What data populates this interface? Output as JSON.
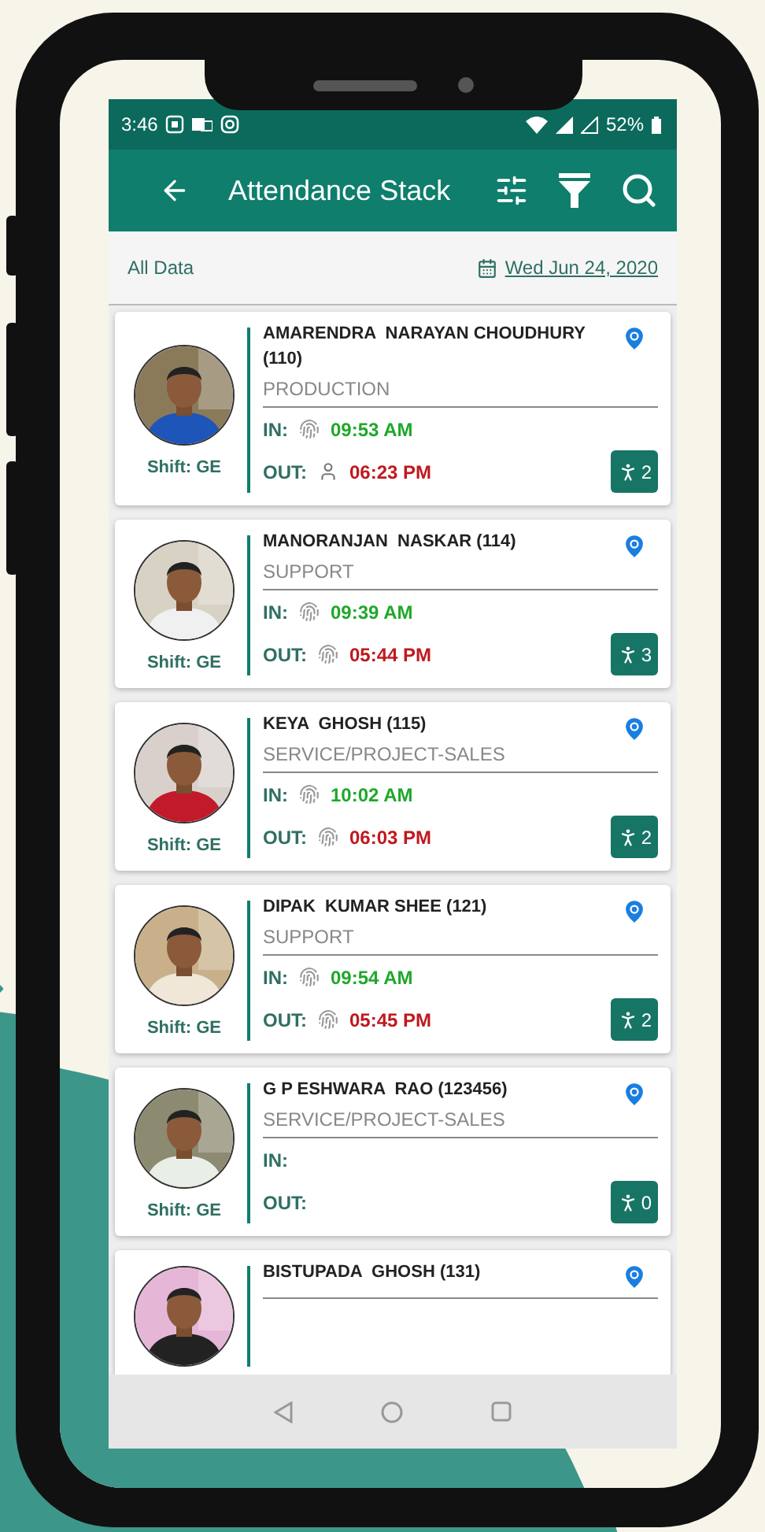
{
  "status_bar": {
    "time": "3:46",
    "battery": "52%"
  },
  "toolbar": {
    "title": "Attendance Stack"
  },
  "subheader": {
    "filter": "All Data",
    "date": "Wed Jun 24, 2020"
  },
  "employees": [
    {
      "name": "AMARENDRA  NARAYAN CHOUDHURY (110)",
      "department": "PRODUCTION",
      "shift": "Shift: GE",
      "check_in": {
        "label": "IN:",
        "kind": "fingerprint",
        "time": "09:53 AM"
      },
      "check_out": {
        "label": "OUT:",
        "kind": "manual",
        "time": "06:23 PM"
      },
      "count": "2"
    },
    {
      "name": "MANORANJAN  NASKAR (114)",
      "department": "SUPPORT",
      "shift": "Shift: GE",
      "check_in": {
        "label": "IN:",
        "kind": "fingerprint",
        "time": "09:39 AM"
      },
      "check_out": {
        "label": "OUT:",
        "kind": "fingerprint",
        "time": "05:44 PM"
      },
      "count": "3"
    },
    {
      "name": "KEYA  GHOSH (115)",
      "department": "SERVICE/PROJECT-SALES",
      "shift": "Shift: GE",
      "check_in": {
        "label": "IN:",
        "kind": "fingerprint",
        "time": "10:02 AM"
      },
      "check_out": {
        "label": "OUT:",
        "kind": "fingerprint",
        "time": "06:03 PM"
      },
      "count": "2"
    },
    {
      "name": "DIPAK  KUMAR SHEE (121)",
      "department": "SUPPORT",
      "shift": "Shift: GE",
      "check_in": {
        "label": "IN:",
        "kind": "fingerprint",
        "time": "09:54 AM"
      },
      "check_out": {
        "label": "OUT:",
        "kind": "fingerprint",
        "time": "05:45 PM"
      },
      "count": "2"
    },
    {
      "name": "G P ESHWARA  RAO (123456)",
      "department": "SERVICE/PROJECT-SALES",
      "shift": "Shift: GE",
      "check_in": {
        "label": "IN:"
      },
      "check_out": {
        "label": "OUT:"
      },
      "count": "0"
    },
    {
      "name": "BISTUPADA  GHOSH (131)"
    }
  ]
}
